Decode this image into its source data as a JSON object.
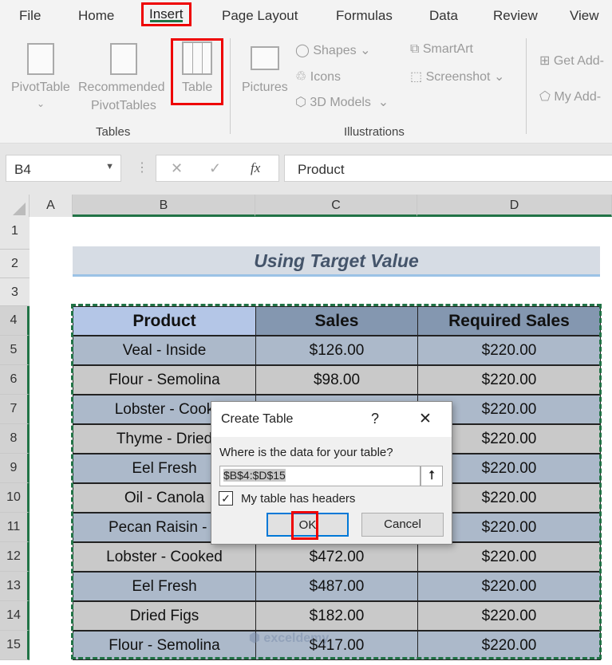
{
  "menu": {
    "tabs": [
      "File",
      "Home",
      "Insert",
      "Page Layout",
      "Formulas",
      "Data",
      "Review",
      "View"
    ],
    "active": "Insert"
  },
  "ribbon": {
    "tables": {
      "group": "Tables",
      "pivot": "PivotTable",
      "recommended1": "Recommended",
      "recommended2": "PivotTables",
      "table": "Table"
    },
    "illustrations": {
      "group": "Illustrations",
      "pictures": "Pictures",
      "shapes": "Shapes",
      "icons": "Icons",
      "models": "3D Models",
      "smartart": "SmartArt",
      "screenshot": "Screenshot"
    },
    "addins": {
      "get": "Get Add-",
      "my": "My Add-"
    }
  },
  "formula_bar": {
    "name_box": "B4",
    "fx": "fx",
    "content": "Product"
  },
  "columns": [
    "A",
    "B",
    "C",
    "D"
  ],
  "rows": [
    "1",
    "2",
    "3",
    "4",
    "5",
    "6",
    "7",
    "8",
    "9",
    "10",
    "11",
    "12",
    "13",
    "14",
    "15"
  ],
  "sheet": {
    "title": "Using Target Value",
    "headers": [
      "Product",
      "Sales",
      "Required Sales"
    ],
    "data": [
      [
        "Veal - Inside",
        "$126.00",
        "$220.00"
      ],
      [
        "Flour - Semolina",
        "$98.00",
        "$220.00"
      ],
      [
        "Lobster - Cook",
        "",
        "$220.00"
      ],
      [
        "Thyme - Dried",
        "",
        "$220.00"
      ],
      [
        "Eel Fresh",
        "",
        "$220.00"
      ],
      [
        "Oil - Canola",
        "",
        "$220.00"
      ],
      [
        "Pecan Raisin - T",
        "",
        "$220.00"
      ],
      [
        "Lobster - Cooked",
        "$472.00",
        "$220.00"
      ],
      [
        "Eel Fresh",
        "$487.00",
        "$220.00"
      ],
      [
        "Dried Figs",
        "$182.00",
        "$220.00"
      ],
      [
        "Flour - Semolina",
        "$417.00",
        "$220.00"
      ]
    ]
  },
  "dialog": {
    "title": "Create Table",
    "help": "?",
    "close": "✕",
    "prompt": "Where is the data for your table?",
    "range": "$B$4:$D$15",
    "checkbox_label": "My table has headers",
    "checked": true,
    "ok": "OK",
    "cancel": "Cancel"
  },
  "colors": {
    "header_product": "#b4c6e7",
    "header_other": "#8497b0",
    "row_odd": "#acb9ca",
    "row_even": "#c9c9c9",
    "highlight": "#ee0000",
    "accent": "#217346"
  }
}
